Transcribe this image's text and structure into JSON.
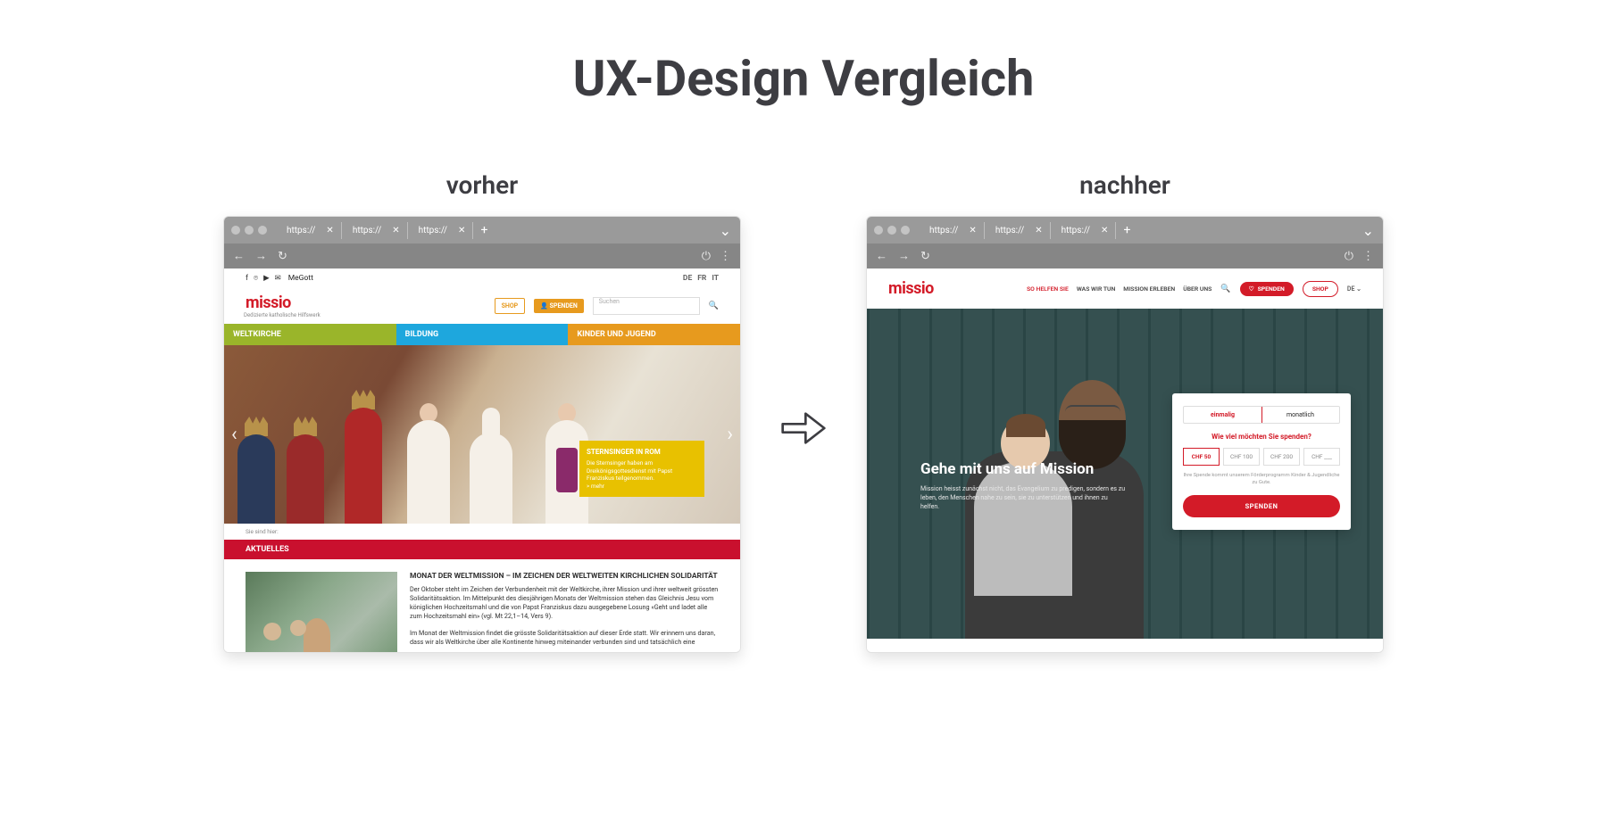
{
  "title": "UX-Design Vergleich",
  "labels": {
    "before": "vorher",
    "after": "nachher"
  },
  "browser": {
    "tabs": [
      "https://",
      "https://",
      "https://"
    ]
  },
  "before": {
    "top": {
      "media": "MeGott",
      "langs": [
        "DE",
        "FR",
        "IT"
      ]
    },
    "brand": "missio",
    "tagline": "Dedizierte katholische Hilfswerk",
    "shop": "SHOP",
    "spenden": "SPENDEN",
    "search": "Suchen",
    "cats": [
      {
        "label": "WELTKIRCHE",
        "color": "#9ab52a"
      },
      {
        "label": "BILDUNG",
        "color": "#1ea7dd"
      },
      {
        "label": "KINDER UND JUGEND",
        "color": "#e79a1e"
      }
    ],
    "caption": {
      "title": "STERNSINGER IN ROM",
      "body": "Die Sternsinger haben am Dreikönigsgottesdienst mit Papst Franziskus teilgenommen.",
      "more": "> mehr"
    },
    "breadcrumb": "Sie sind hier: ",
    "band": "AKTUELLES",
    "article": {
      "title": "MONAT DER WELTMISSION – IM ZEICHEN DER WELTWEITEN KIRCHLICHEN SOLIDARITÄT",
      "p1": "Der Oktober steht im Zeichen der Verbundenheit mit der Weltkirche, ihrer Mission und ihrer weltweit grössten Solidaritätsaktion. Im Mittelpunkt des diesjährigen Monats der Weltmission stehen das Gleichnis Jesu vom königlichen Hochzeitsmahl und die von Papst Franziskus dazu ausgegebene Losung «Geht und ladet alle zum Hochzeitsmahl ein» (vgl. Mt 22,1–14, Vers 9).",
      "p2": "Im Monat der Weltmission findet die grösste Solidaritätsaktion auf dieser Erde statt. Wir erinnern uns daran, dass wir als Weltkirche über alle Kontinente hinweg miteinander verbunden sind und tatsächlich eine"
    }
  },
  "after": {
    "brand": "missio",
    "nav": [
      {
        "label": "SO HELFEN SIE",
        "hl": true
      },
      {
        "label": "WAS WIR TUN"
      },
      {
        "label": "MISSION ERLEBEN"
      },
      {
        "label": "ÜBER UNS"
      }
    ],
    "spenden": "SPENDEN",
    "shop": "SHOP",
    "lang": "DE",
    "hero": {
      "title": "Gehe mit uns auf Mission",
      "sub": "Mission heisst zunächst nicht, das Evangelium zu predigen, sondern es zu leben, den Menschen nahe zu sein, sie zu unterstützen und ihnen zu helfen."
    },
    "card": {
      "tabs": [
        "einmalig",
        "monatlich"
      ],
      "ask": "Wie viel möchten Sie spenden?",
      "amounts": [
        "CHF 50",
        "CHF 100",
        "CHF 200",
        "CHF ___"
      ],
      "note": "Ihre Spende kommt unserem Förderprogramm Kinder & Jugendliche zu Gute.",
      "cta": "SPENDEN"
    }
  }
}
